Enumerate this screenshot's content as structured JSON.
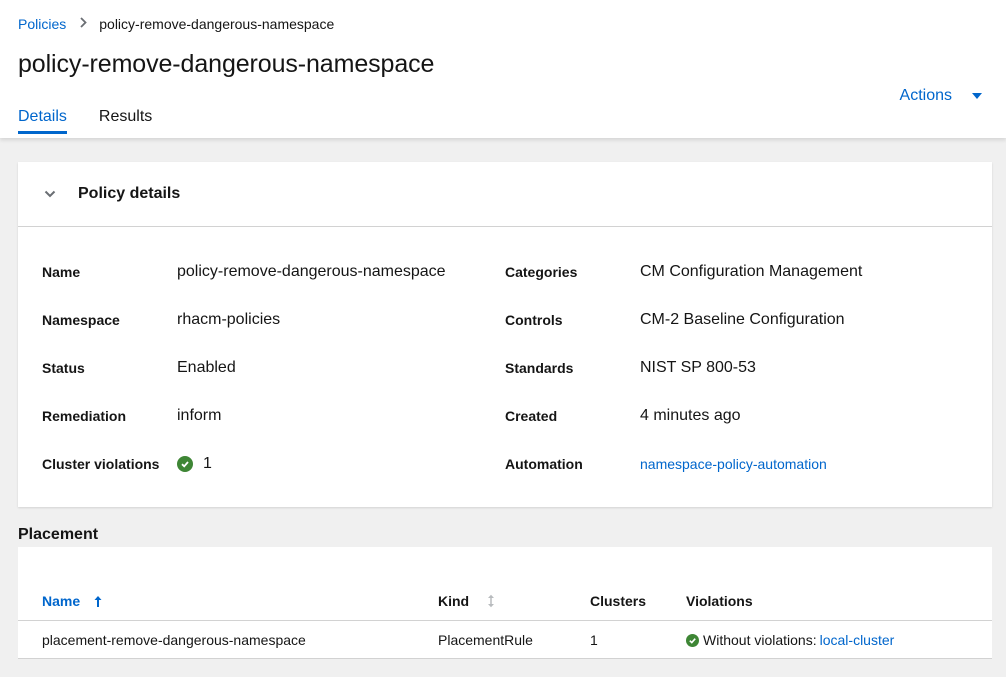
{
  "breadcrumb": {
    "root": "Policies",
    "current": "policy-remove-dangerous-namespace"
  },
  "page": {
    "title": "policy-remove-dangerous-namespace",
    "actions_label": "Actions"
  },
  "tabs": [
    {
      "label": "Details"
    },
    {
      "label": "Results"
    }
  ],
  "details": {
    "title": "Policy details",
    "left": [
      {
        "term": "Name",
        "value": "policy-remove-dangerous-namespace"
      },
      {
        "term": "Namespace",
        "value": "rhacm-policies"
      },
      {
        "term": "Status",
        "value": "Enabled"
      },
      {
        "term": "Remediation",
        "value": "inform"
      },
      {
        "term": "Cluster violations",
        "value": "1"
      }
    ],
    "right": [
      {
        "term": "Categories",
        "value": "CM Configuration Management"
      },
      {
        "term": "Controls",
        "value": "CM-2 Baseline Configuration"
      },
      {
        "term": "Standards",
        "value": "NIST SP 800-53"
      },
      {
        "term": "Created",
        "value": "4 minutes ago"
      },
      {
        "term": "Automation",
        "value": "namespace-policy-automation"
      }
    ]
  },
  "placement": {
    "title": "Placement",
    "columns": [
      "Name",
      "Kind",
      "Clusters",
      "Violations"
    ],
    "rows": [
      {
        "name": "placement-remove-dangerous-namespace",
        "kind": "PlacementRule",
        "clusters": "1",
        "violations_text": "Without violations:",
        "violations_link": "local-cluster"
      }
    ]
  },
  "colors": {
    "link": "#0066cc",
    "success": "#3e8635"
  }
}
